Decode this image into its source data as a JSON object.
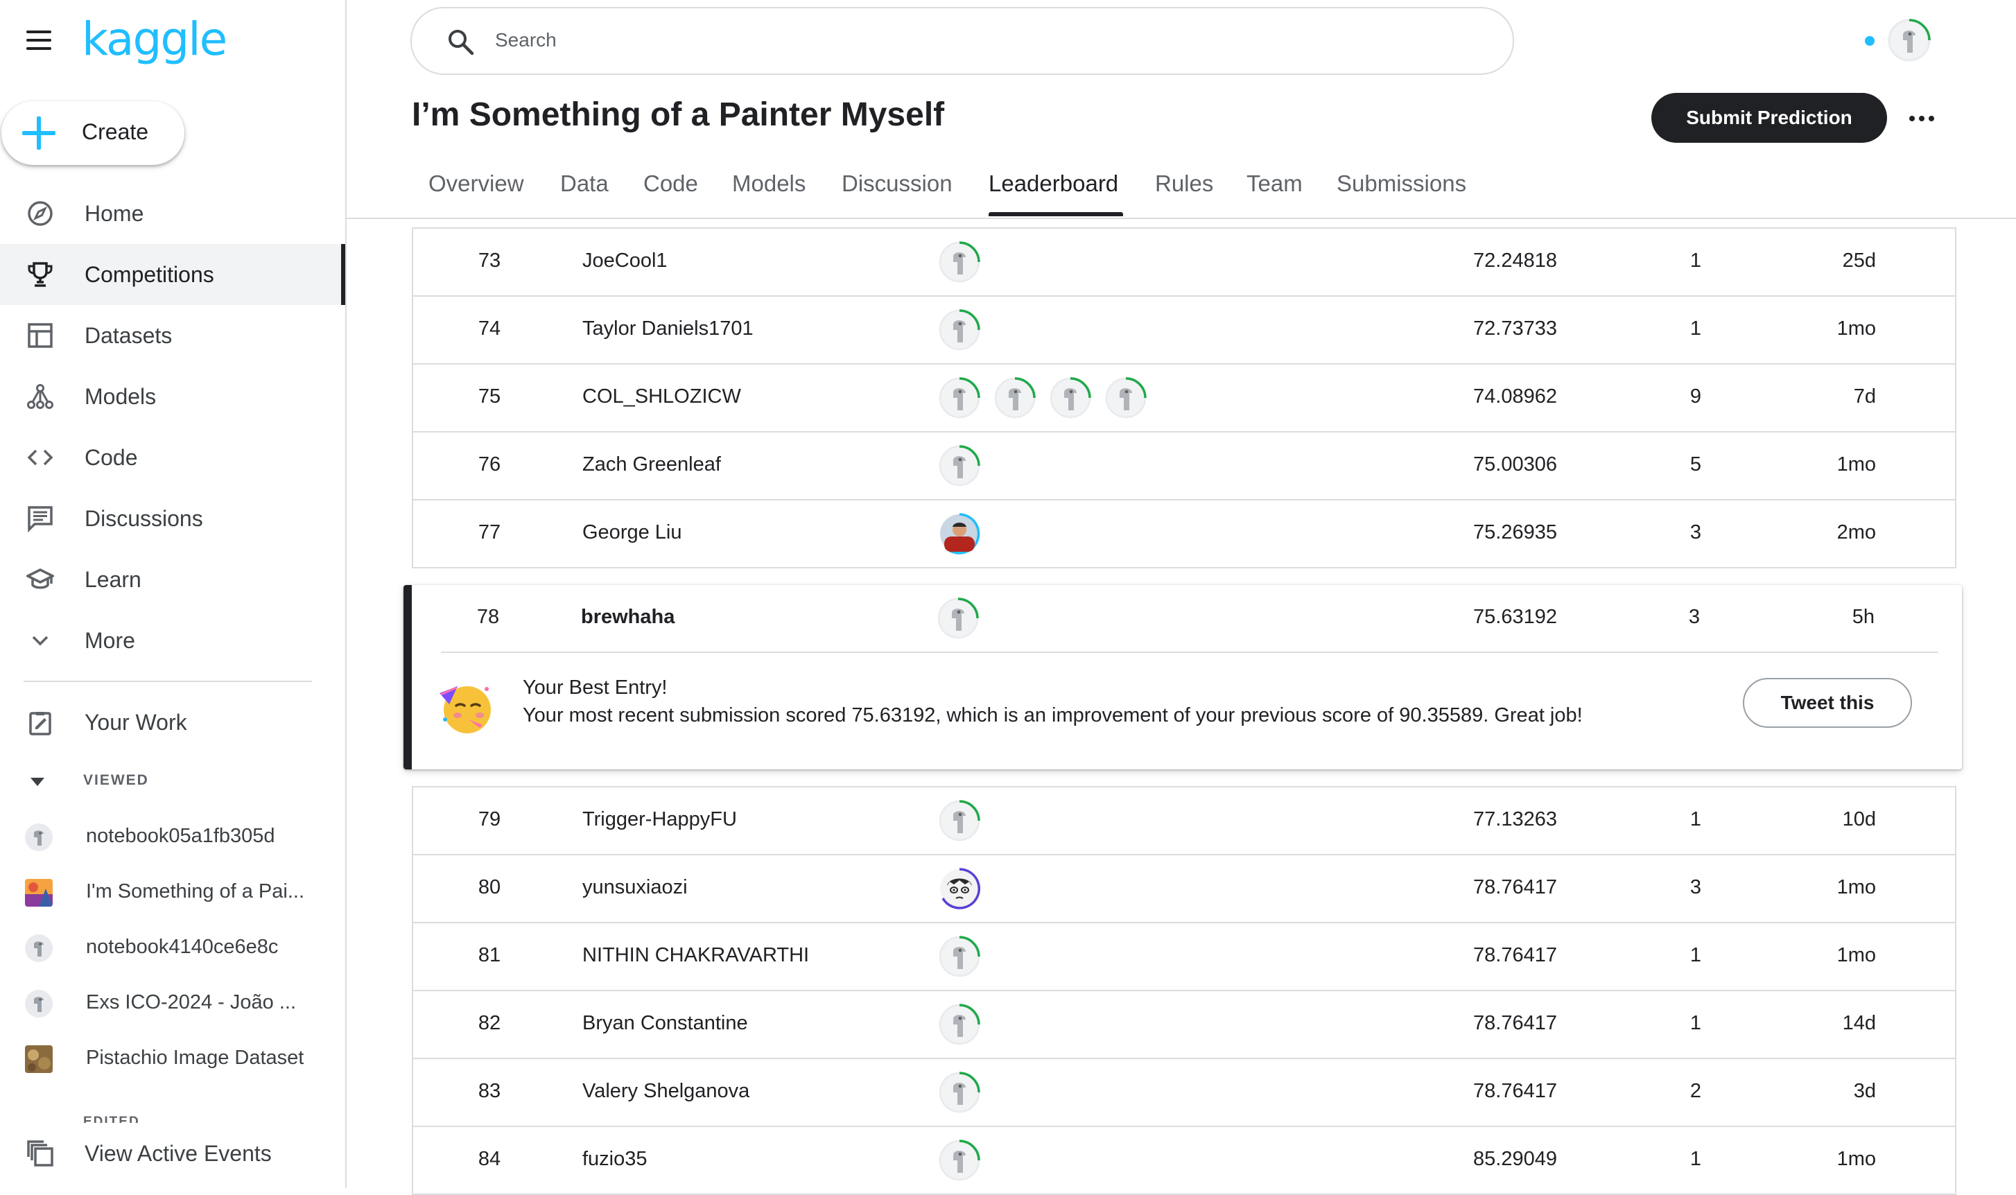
{
  "app": {
    "logo_text": "kaggle",
    "brand_color": "#20beff"
  },
  "sidebar": {
    "create_label": "Create",
    "nav": [
      {
        "label": "Home",
        "icon": "compass-icon"
      },
      {
        "label": "Competitions",
        "icon": "trophy-icon",
        "active": true
      },
      {
        "label": "Datasets",
        "icon": "table-icon"
      },
      {
        "label": "Models",
        "icon": "models-icon"
      },
      {
        "label": "Code",
        "icon": "code-icon"
      },
      {
        "label": "Discussions",
        "icon": "discussion-icon"
      },
      {
        "label": "Learn",
        "icon": "school-icon"
      },
      {
        "label": "More",
        "icon": "chevron-down-icon"
      }
    ],
    "your_work": "Your Work",
    "viewed_label": "VIEWED",
    "recent": [
      "notebook05a1fb305d",
      "I'm Something of a Pai...",
      "notebook4140ce6e8c",
      "Exs ICO-2024 - João ...",
      "Pistachio Image Dataset"
    ],
    "edited_label": "EDITED",
    "view_active_events": "View Active Events"
  },
  "header": {
    "search_placeholder": "Search",
    "title": "I’m Something of a Painter Myself",
    "submit_label": "Submit Prediction",
    "tabs": [
      "Overview",
      "Data",
      "Code",
      "Models",
      "Discussion",
      "Leaderboard",
      "Rules",
      "Team",
      "Submissions"
    ],
    "active_tab": "Leaderboard"
  },
  "leaderboard": {
    "rows_before": [
      {
        "rank": "73",
        "team": "JoeCool1",
        "score": "72.24818",
        "entries": "1",
        "last": "25d"
      },
      {
        "rank": "74",
        "team": "Taylor Daniels1701",
        "score": "72.73733",
        "entries": "1",
        "last": "1mo"
      },
      {
        "rank": "75",
        "team": "COL_SHLOZICW",
        "score": "74.08962",
        "entries": "9",
        "last": "7d"
      },
      {
        "rank": "76",
        "team": "Zach Greenleaf",
        "score": "75.00306",
        "entries": "5",
        "last": "1mo"
      },
      {
        "rank": "77",
        "team": "George Liu",
        "score": "75.26935",
        "entries": "3",
        "last": "2mo"
      }
    ],
    "best": {
      "rank": "78",
      "team": "brewhaha",
      "score": "75.63192",
      "entries": "3",
      "last": "5h",
      "title": "Your Best Entry!",
      "message": "Your most recent submission scored 75.63192, which is an improvement of your previous score of 90.35589. Great job!",
      "tweet_label": "Tweet this"
    },
    "rows_after": [
      {
        "rank": "79",
        "team": "Trigger-HappyFU",
        "score": "77.13263",
        "entries": "1",
        "last": "10d"
      },
      {
        "rank": "80",
        "team": "yunsuxiaozi",
        "score": "78.76417",
        "entries": "3",
        "last": "1mo"
      },
      {
        "rank": "81",
        "team": "NITHIN CHAKRAVARTHI",
        "score": "78.76417",
        "entries": "1",
        "last": "1mo"
      },
      {
        "rank": "82",
        "team": "Bryan Constantine",
        "score": "78.76417",
        "entries": "1",
        "last": "14d"
      },
      {
        "rank": "83",
        "team": "Valery Shelganova",
        "score": "78.76417",
        "entries": "2",
        "last": "3d"
      },
      {
        "rank": "84",
        "team": "fuzio35",
        "score": "85.29049",
        "entries": "1",
        "last": "1mo"
      }
    ]
  }
}
